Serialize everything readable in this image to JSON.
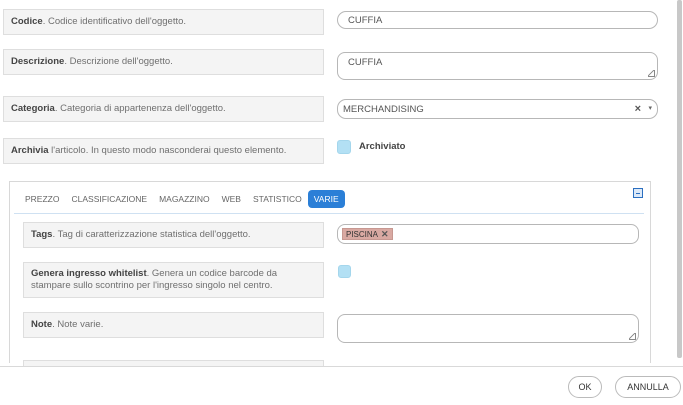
{
  "fields": {
    "codice": {
      "label": "Codice",
      "desc": ". Codice identificativo dell'oggetto.",
      "value": "CUFFIA"
    },
    "descrizione": {
      "label": "Descrizione",
      "desc": ". Descrizione dell'oggetto.",
      "value": "CUFFIA"
    },
    "categoria": {
      "label": "Categoria",
      "desc": ". Categoria di appartenenza dell'oggetto.",
      "value": "MERCHANDISING",
      "clear": "×",
      "arrow": "▾"
    },
    "archivia": {
      "label": "Archivia",
      "desc": " l'articolo. In questo modo nasconderai questo elemento.",
      "checkbox_label": "Archiviato"
    }
  },
  "tabs": {
    "items": [
      "PREZZO",
      "CLASSIFICAZIONE",
      "MAGAZZINO",
      "WEB",
      "STATISTICO",
      "VARIE"
    ],
    "active_index": 5
  },
  "varie": {
    "tags": {
      "label": "Tags",
      "desc": ". Tag di caratterizzazione statistica dell'oggetto.",
      "tag": "PISCINA",
      "tag_remove": "✕"
    },
    "whitelist": {
      "label": "Genera ingresso whitelist",
      "desc": ". Genera un codice barcode da stampare sullo scontrino per l'ingresso singolo nel centro."
    },
    "note": {
      "label": "Note",
      "desc": ". Note varie.",
      "value": ""
    }
  },
  "footer": {
    "ok_label": "OK",
    "cancel_label": "ANNULLA"
  },
  "colors": {
    "accent": "#2b7fd7",
    "checkbox": "#b3e0f4",
    "tag": "#d9a9a2"
  }
}
